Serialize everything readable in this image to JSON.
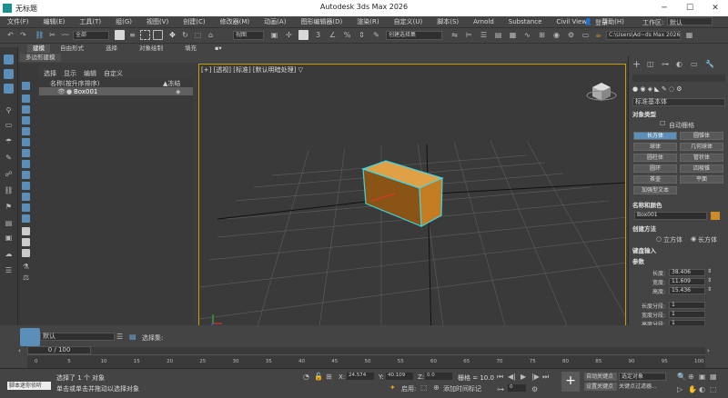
{
  "title_bar": {
    "doc_title": "无标题",
    "app_title": "Autodesk 3ds Max 2026",
    "minimize": "─",
    "maximize": "☐",
    "close": "✕"
  },
  "menu": [
    "文件(F)",
    "编辑(E)",
    "工具(T)",
    "组(G)",
    "视图(V)",
    "创建(C)",
    "修改器(M)",
    "动画(A)",
    "图形编辑器(D)",
    "渲染(R)",
    "自定义(U)",
    "脚本(S)",
    "Arnold",
    "Substance",
    "Civil View",
    "帮助(H)"
  ],
  "account": {
    "user": "登录",
    "workspace_label": "工作区:",
    "workspace_value": "默认"
  },
  "toolbar": {
    "filter": "全部",
    "refcoord": "视图",
    "selset": "创建选择集",
    "project_path": "C:\\Users\\Ad~ds Max 2026"
  },
  "ribbon": {
    "tabs": [
      "建模",
      "自由形式",
      "选择",
      "对象绘制",
      "填充"
    ],
    "sub": "多边形建模"
  },
  "explorer": {
    "tabs": [
      "选择",
      "显示",
      "编辑",
      "自定义"
    ],
    "col_name": "名称(按升序排序)",
    "col_freeze": "▲冻结",
    "rows": [
      {
        "name": "Box001"
      }
    ],
    "layer": "默认",
    "selset_label": "选择集:"
  },
  "viewport": {
    "label": "[+] [透视] [标准] [默认明暗处理] ▽"
  },
  "command_panel": {
    "category": "标准基本体",
    "sections": {
      "object_type": "对象类型",
      "name_color": "名称和颜色",
      "creation_method": "创建方法",
      "keyboard_entry": "键盘输入",
      "params": "参数"
    },
    "autogrid": "自动栅格",
    "buttons": [
      "长方体",
      "圆锥体",
      "球体",
      "几何球体",
      "圆柱体",
      "管状体",
      "圆环",
      "四棱锥",
      "茶壶",
      "平面",
      "加强型文本"
    ],
    "active_button": "长方体",
    "object_name": "Box001",
    "creation_options": [
      "立方体",
      "长方体"
    ],
    "params": [
      {
        "label": "长度:",
        "value": "38.406"
      },
      {
        "label": "宽度:",
        "value": "11.609"
      },
      {
        "label": "高度:",
        "value": "15.436"
      },
      {
        "label": "长度分段:",
        "value": "1"
      },
      {
        "label": "宽度分段:",
        "value": "1"
      },
      {
        "label": "高度分段:",
        "value": "1"
      }
    ]
  },
  "timeline": {
    "frame_display": "0 / 100",
    "ticks": [
      "0",
      "5",
      "10",
      "15",
      "20",
      "25",
      "30",
      "35",
      "40",
      "45",
      "50",
      "55",
      "60",
      "65",
      "70",
      "75",
      "80",
      "85",
      "90",
      "95",
      "100"
    ]
  },
  "status": {
    "selected": "选择了 1 个 对象",
    "hint": "单击或单击并拖动以选择对象",
    "maxscript": "脚本迷你侦听",
    "x_label": "X:",
    "x_val": "24.574",
    "y_label": "Y:",
    "y_val": "40.109",
    "z_label": "Z:",
    "z_val": "0.0",
    "grid": "栅格 = 10.0",
    "enabled": "启用:",
    "add_tag": "添加时间标记",
    "auto_key": "自动关键点",
    "set_key": "设置关键点",
    "sel_obj": "选定对象",
    "key_filters": "关键点过滤器..."
  },
  "colors": {
    "accent": "#5b8fb9",
    "box_fill": "#d08b28",
    "box_outline": "#3fd6e6",
    "viewport_border": "#c8a000"
  }
}
